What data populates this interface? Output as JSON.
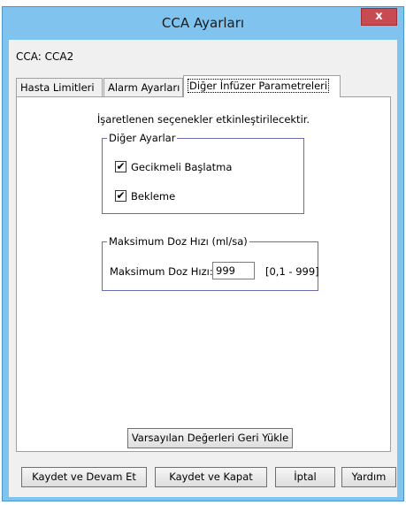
{
  "window": {
    "title": "CCA Ayarları",
    "close_label": "x"
  },
  "cca_label": "CCA: CCA2",
  "tabs": [
    {
      "label": "Hasta Limitleri"
    },
    {
      "label": "Alarm Ayarları"
    },
    {
      "label": "Diğer İnfüzer Parametreleri"
    }
  ],
  "panel": {
    "info_text": "İşaretlenen seçenekler etkinleştirilecektir.",
    "other_settings": {
      "legend": "Diğer Ayarlar",
      "options": [
        {
          "label": "Gecikmeli Başlatma",
          "checked": true
        },
        {
          "label": "Bekleme",
          "checked": true
        }
      ],
      "check_glyph": "✔"
    },
    "max_dose": {
      "legend": "Maksimum Doz Hızı (ml/sa)",
      "label": "Maksimum Doz Hızı:",
      "value": "999",
      "range": "[0,1 - 999]"
    },
    "restore_defaults_label": "Varsayılan Değerleri Geri Yükle"
  },
  "footer": {
    "save_continue": "Kaydet ve Devam Et",
    "save_close": "Kaydet ve Kapat",
    "cancel": "İptal",
    "help": "Yardım"
  }
}
